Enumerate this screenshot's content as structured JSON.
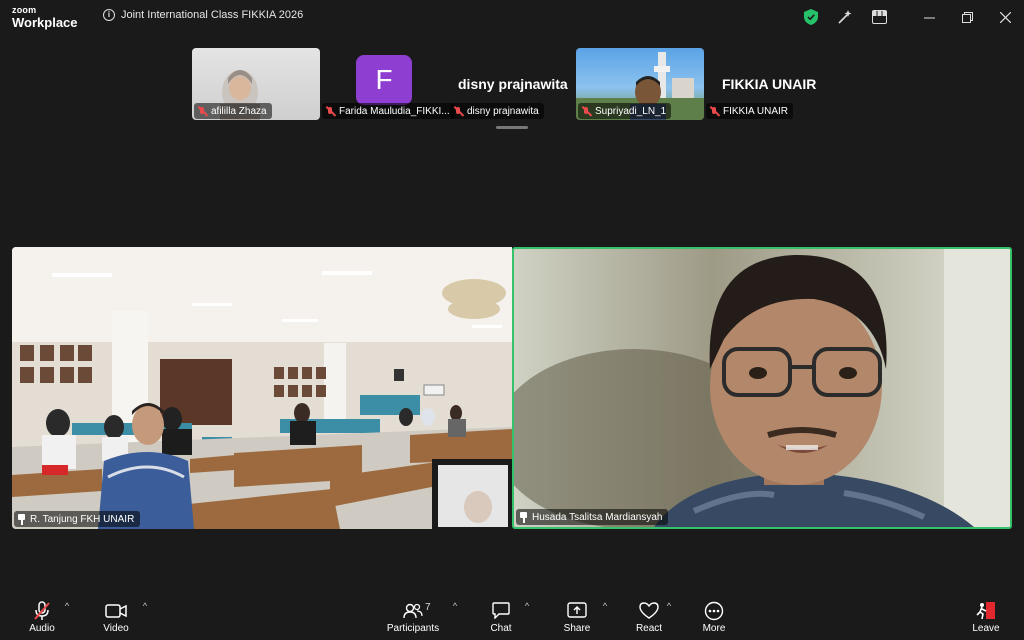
{
  "titlebar": {
    "brand_line1": "zoom",
    "brand_line2": "Workplace",
    "meeting_title": "Joint International Class FIKKIA 2026"
  },
  "gallery": {
    "participants": [
      {
        "name": "afililla Zhaza",
        "muted": true
      },
      {
        "name": "Farida Mauludia_FIKKI...",
        "muted": true,
        "avatar_letter": "F",
        "avatar_color": "#8e3fd1"
      },
      {
        "name": "disny prajnawita",
        "muted": true,
        "display_name": "disny prajnawita"
      },
      {
        "name": "Supriyadi_LN_1",
        "muted": true
      },
      {
        "name": "FIKKIA UNAIR",
        "muted": true,
        "display_name": "FIKKIA UNAIR"
      }
    ]
  },
  "main": {
    "left_video": {
      "name": "R. Tanjung FKH UNAIR",
      "pinned": true
    },
    "right_video": {
      "name": "Husada Tsalitsa Mardiansyah",
      "pinned": true,
      "active_speaker_color": "#35c26b"
    }
  },
  "toolbar": {
    "audio": "Audio",
    "video": "Video",
    "participants": "Participants",
    "participants_count": "7",
    "chat": "Chat",
    "share": "Share",
    "react": "React",
    "more": "More",
    "leave": "Leave",
    "leave_color": "#e0282e"
  },
  "colors": {
    "background": "#1a1a1a",
    "security_shield": "#26c26a",
    "muted_mic": "#ea4a4a"
  }
}
